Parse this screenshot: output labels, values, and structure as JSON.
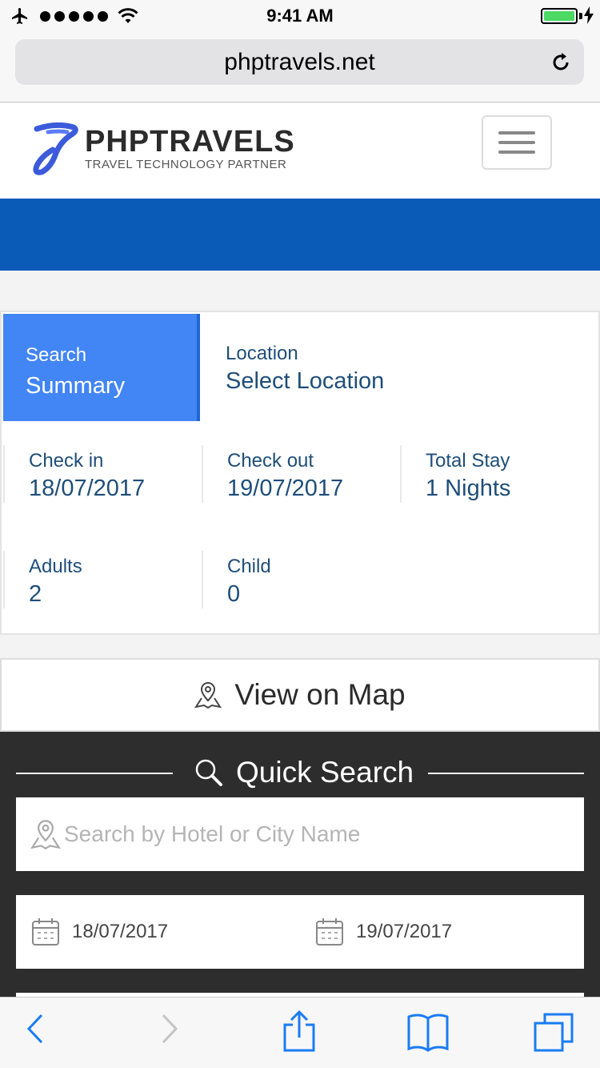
{
  "status_bar": {
    "time": "9:41 AM",
    "battery_level": 1.0
  },
  "browser": {
    "url": "phptravels.net"
  },
  "site": {
    "logo_title": "PHPTRAVELS",
    "logo_subtitle": "TRAVEL TECHNOLOGY PARTNER",
    "brand_color": "#0a5bb8"
  },
  "summary": {
    "heading_line1": "Search",
    "heading_line2": "Summary",
    "location_label": "Location",
    "location_value": "Select Location",
    "checkin_label": "Check in",
    "checkin_value": "18/07/2017",
    "checkout_label": "Check out",
    "checkout_value": "19/07/2017",
    "total_label": "Total Stay",
    "total_value": "1 Nights",
    "adults_label": "Adults",
    "adults_value": "2",
    "child_label": "Child",
    "child_value": "0"
  },
  "map_button": {
    "label": "View on Map"
  },
  "quick_search": {
    "title": "Quick Search",
    "search_placeholder": "Search by Hotel or City Name",
    "checkin_date": "18/07/2017",
    "checkout_date": "19/07/2017"
  },
  "colors": {
    "accent": "#4285f4",
    "text_blue": "#1f4e79",
    "dark_panel": "#2d2d2d",
    "ios_blue": "#1a7cf5"
  }
}
